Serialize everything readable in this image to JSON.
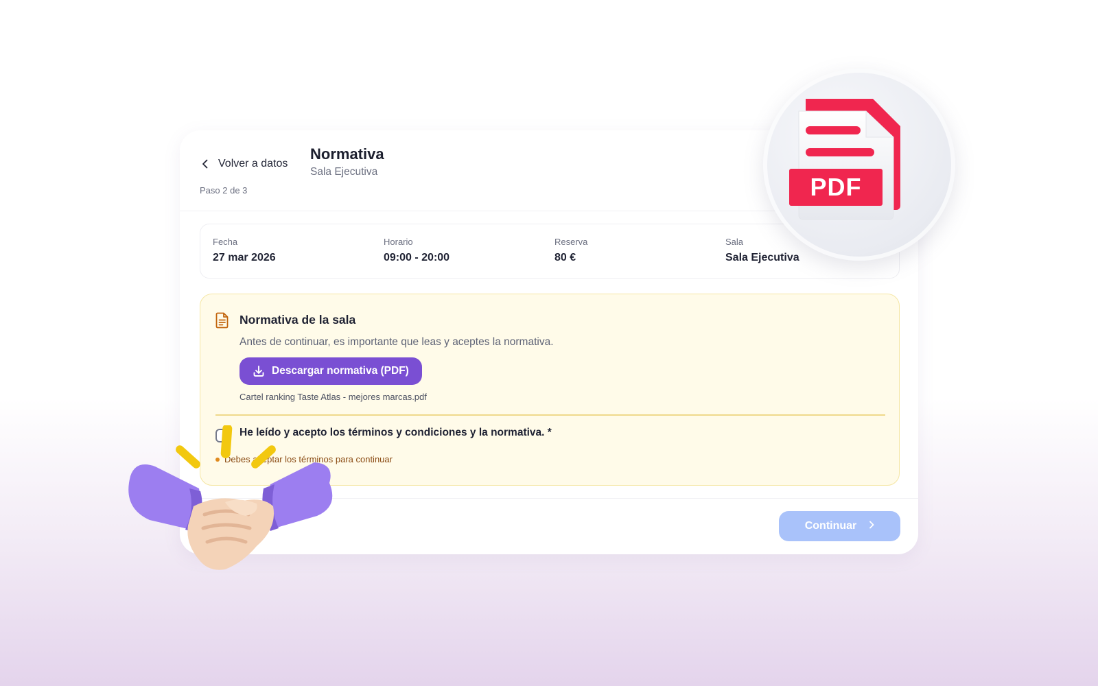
{
  "header": {
    "back_label": "Volver a datos",
    "title": "Normativa",
    "subtitle": "Sala Ejecutiva",
    "step": "Paso 2 de 3"
  },
  "summary": {
    "date": {
      "label": "Fecha",
      "value": "27 mar 2026"
    },
    "schedule": {
      "label": "Horario",
      "value": "09:00 - 20:00"
    },
    "booking": {
      "label": "Reserva",
      "value": "80 €"
    },
    "room": {
      "label": "Sala",
      "value": "Sala Ejecutiva"
    }
  },
  "rules": {
    "title": "Normativa de la sala",
    "description": "Antes de continuar, es importante que leas y aceptes la normativa.",
    "download_label": "Descargar normativa (PDF)",
    "file_name": "Cartel ranking Taste Atlas - mejores marcas.pdf",
    "accept_label": "He leído y acepto los términos y condiciones y la normativa. *",
    "accept_checked": false,
    "error": "Debes aceptar los términos para continuar"
  },
  "footer": {
    "continue_label": "Continuar",
    "continue_enabled": false
  },
  "decor": {
    "pdf_badge_text": "PDF",
    "icons": [
      "chevron-left-icon",
      "document-icon",
      "download-icon",
      "chevron-right-icon",
      "pdf-file-icon",
      "handshake-icon"
    ]
  },
  "colors": {
    "accent": "#7a4fd3",
    "continue_disabled": "#a9c2fa",
    "warning_bg": "#fffbe9",
    "warning_border": "#f5e6a3",
    "pdf_red": "#f0264f",
    "error_text": "#8a4a12"
  }
}
